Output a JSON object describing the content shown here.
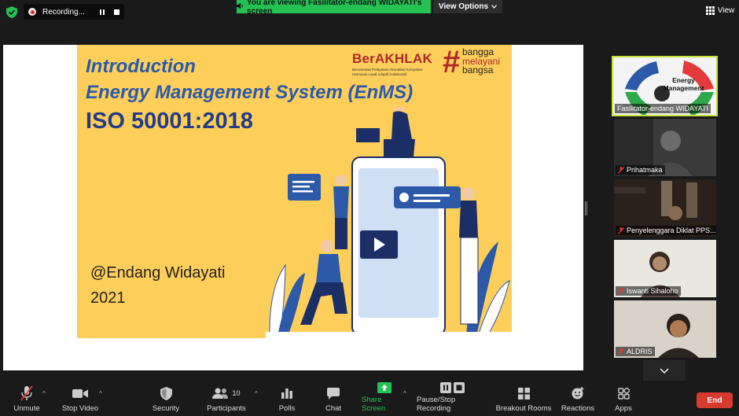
{
  "topbar": {
    "recording_label": "Recording...",
    "viewing_banner": "You are viewing Fasilitator-endang WIDAYATI's screen",
    "view_options_label": "View Options",
    "view_label": "View"
  },
  "slide": {
    "title_line1": "Introduction",
    "title_line2": "Energy Management System (EnMS)",
    "title_line3": "ISO 50001:2018",
    "author": "@Endang Widayati",
    "year": "2021",
    "logo_text": "BerAKHLAK",
    "logo_subtitle_line1": "Berorientasi Pelayanan Akuntabel Kompeten",
    "logo_subtitle_line2": "Harmonis Loyal Adaptif Kolaboratif",
    "hashtag_line1": "bangga",
    "hashtag_line2": "melayani",
    "hashtag_line3": "bangsa"
  },
  "participants": [
    {
      "name": "Fasilitator-endang WIDAYATI",
      "active": true,
      "thumb_text": "Energy Management"
    },
    {
      "name": "Prihatmaka",
      "muted": true
    },
    {
      "name": "Penyelenggara Diklat PPS...",
      "muted": true
    },
    {
      "name": "Iswanti Sihaloho",
      "muted": true
    },
    {
      "name": "ALDRIS",
      "muted": true
    }
  ],
  "toolbar": {
    "unmute": "Unmute",
    "stop_video": "Stop Video",
    "security": "Security",
    "participants": "Participants",
    "participants_count": "10",
    "polls": "Polls",
    "chat": "Chat",
    "share_screen": "Share Screen",
    "pause_stop_recording": "Pause/Stop Recording",
    "breakout_rooms": "Breakout Rooms",
    "reactions": "Reactions",
    "apps": "Apps",
    "end": "End"
  },
  "colors": {
    "accent_green": "#23c253",
    "end_red": "#d93a2f",
    "slide_yellow": "#fece5a",
    "title_blue": "#2c5aa8",
    "active_border": "#c7e03a"
  }
}
